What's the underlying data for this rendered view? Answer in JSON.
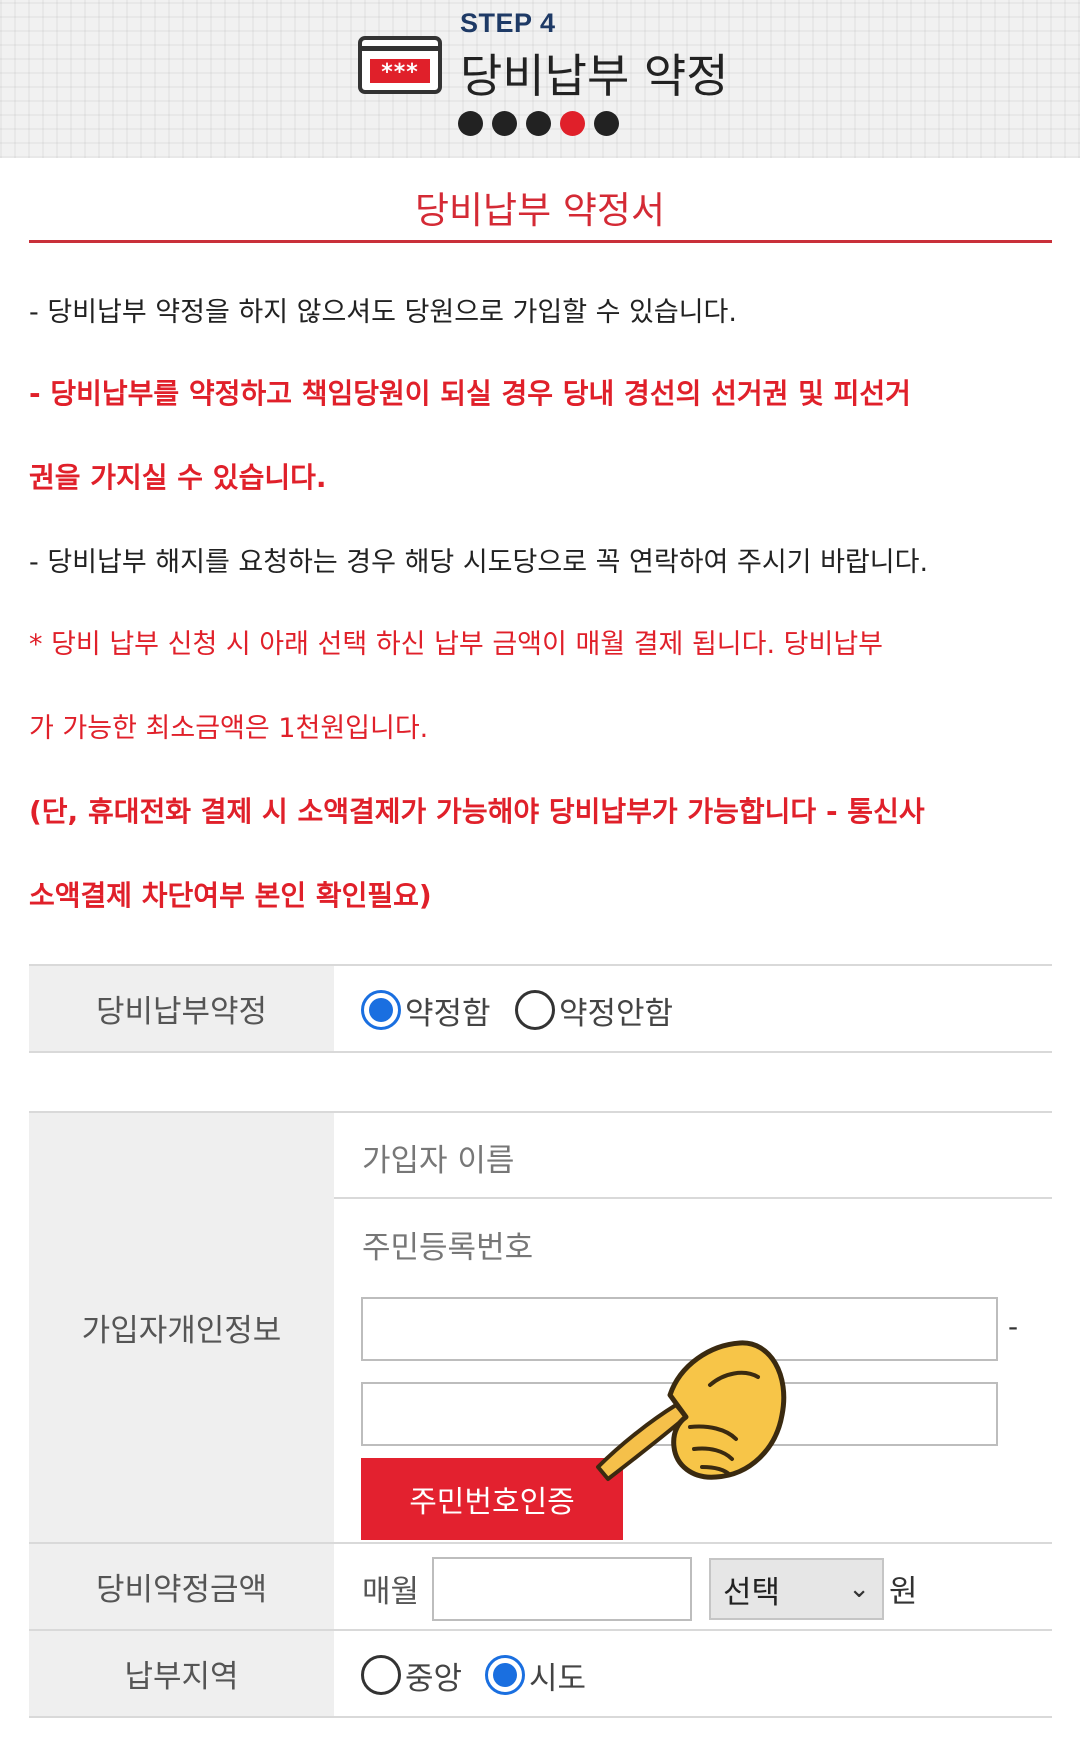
{
  "header": {
    "step_label": "STEP 4",
    "card_stars": "***",
    "title": "당비납부 약정",
    "progress": {
      "total": 5,
      "current": 4
    }
  },
  "section_title": "당비납부 약정서",
  "notices": [
    "- 당비납부 약정을 하지 않으셔도 당원으로 가입할 수 있습니다.",
    "- 당비납부를 약정하고 책임당원이 되실 경우 당내 경선의 선거권 및 피선거",
    "권을 가지실 수 있습니다.",
    "- 당비납부 해지를 요청하는 경우 해당 시도당으로 꼭 연락하여 주시기 바랍니다.",
    "* 당비 납부 신청 시 아래 선택 하신 납부 금액이 매월 결제 됩니다. 당비납부",
    "가 가능한 최소금액은 1천원입니다.",
    "(단, 휴대전화 결제 시 소액결제가 가능해야 당비납부가 가능합니다 - 통신사",
    "소액결제 차단여부 본인 확인필요)"
  ],
  "form": {
    "pledge": {
      "label": "당비납부약정",
      "options": [
        {
          "label": "약정함",
          "checked": true
        },
        {
          "label": "약정안함",
          "checked": false
        }
      ]
    },
    "personal": {
      "label": "가입자개인정보",
      "name_placeholder": "가입자 이름",
      "rrn_label": "주민등록번호",
      "rrn_front_value": "",
      "rrn_back_value": "",
      "rrn_separator": "-",
      "verify_button": "주민번호인증"
    },
    "amount": {
      "label": "당비약정금액",
      "prefix": "매월",
      "value": "",
      "select_value": "선택",
      "unit": "원"
    },
    "region": {
      "label": "납부지역",
      "options": [
        {
          "label": "중앙",
          "checked": false
        },
        {
          "label": "시도",
          "checked": true
        }
      ]
    }
  },
  "colors": {
    "accent_red": "#e0202a",
    "radio_blue": "#1a6fe0",
    "label_bg": "#efefef"
  }
}
